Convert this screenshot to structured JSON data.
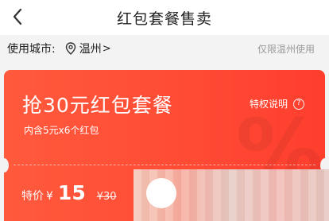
{
  "header": {
    "back_icon": "chevron-left-icon",
    "title": "红包套餐售卖"
  },
  "city": {
    "label": "使用城市:",
    "pin_icon": "location-pin-icon",
    "name": "温州",
    "arrow": ">",
    "note": "仅限温州使用"
  },
  "card": {
    "title": "抢30元红包套餐",
    "subtitle": "内含5元x6个红包",
    "rights_label": "特权说明",
    "rights_icon": "question-circle-icon",
    "watermark": "%",
    "price_label": "特价",
    "price_symbol": "¥",
    "price_value": "15",
    "original_price": "¥30"
  },
  "colors": {
    "card_gradient_start": "#ff5a3d",
    "card_gradient_end": "#ff3e2e",
    "page_bg": "#f3f3f3"
  }
}
